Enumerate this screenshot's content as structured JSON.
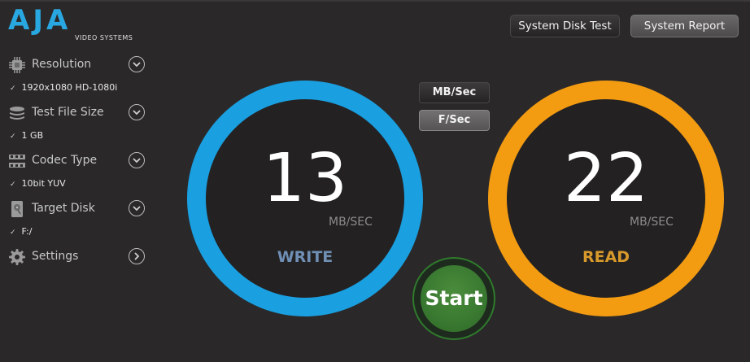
{
  "brand": {
    "logo_text": "AJA",
    "logo_sub": "VIDEO SYSTEMS",
    "color": "#29a7e1"
  },
  "header": {
    "system_disk_test": "System Disk Test",
    "system_report": "System Report"
  },
  "sidebar": {
    "resolution": {
      "label": "Resolution",
      "value": "1920x1080 HD-1080i",
      "icon": "chip-icon"
    },
    "test_file_size": {
      "label": "Test File Size",
      "value": "1 GB",
      "icon": "layers-icon"
    },
    "codec_type": {
      "label": "Codec Type",
      "value": "10bit YUV",
      "icon": "film-strip-icon"
    },
    "target_disk": {
      "label": "Target Disk",
      "value": "F:/",
      "icon": "hard-disk-icon"
    },
    "settings": {
      "label": "Settings",
      "icon": "gear-icon"
    }
  },
  "units": {
    "mb_sec": "MB/Sec",
    "f_sec": "F/Sec",
    "selected": "F/Sec"
  },
  "write": {
    "value": "13",
    "unit": "MB/SEC",
    "label": "WRITE",
    "color": "#1a9fe0",
    "label_color": "#6f8fb4"
  },
  "read": {
    "value": "22",
    "unit": "MB/SEC",
    "label": "READ",
    "color": "#f39c12",
    "label_color": "#d89a2a"
  },
  "start": {
    "label": "Start",
    "color": "#3e7e34"
  }
}
